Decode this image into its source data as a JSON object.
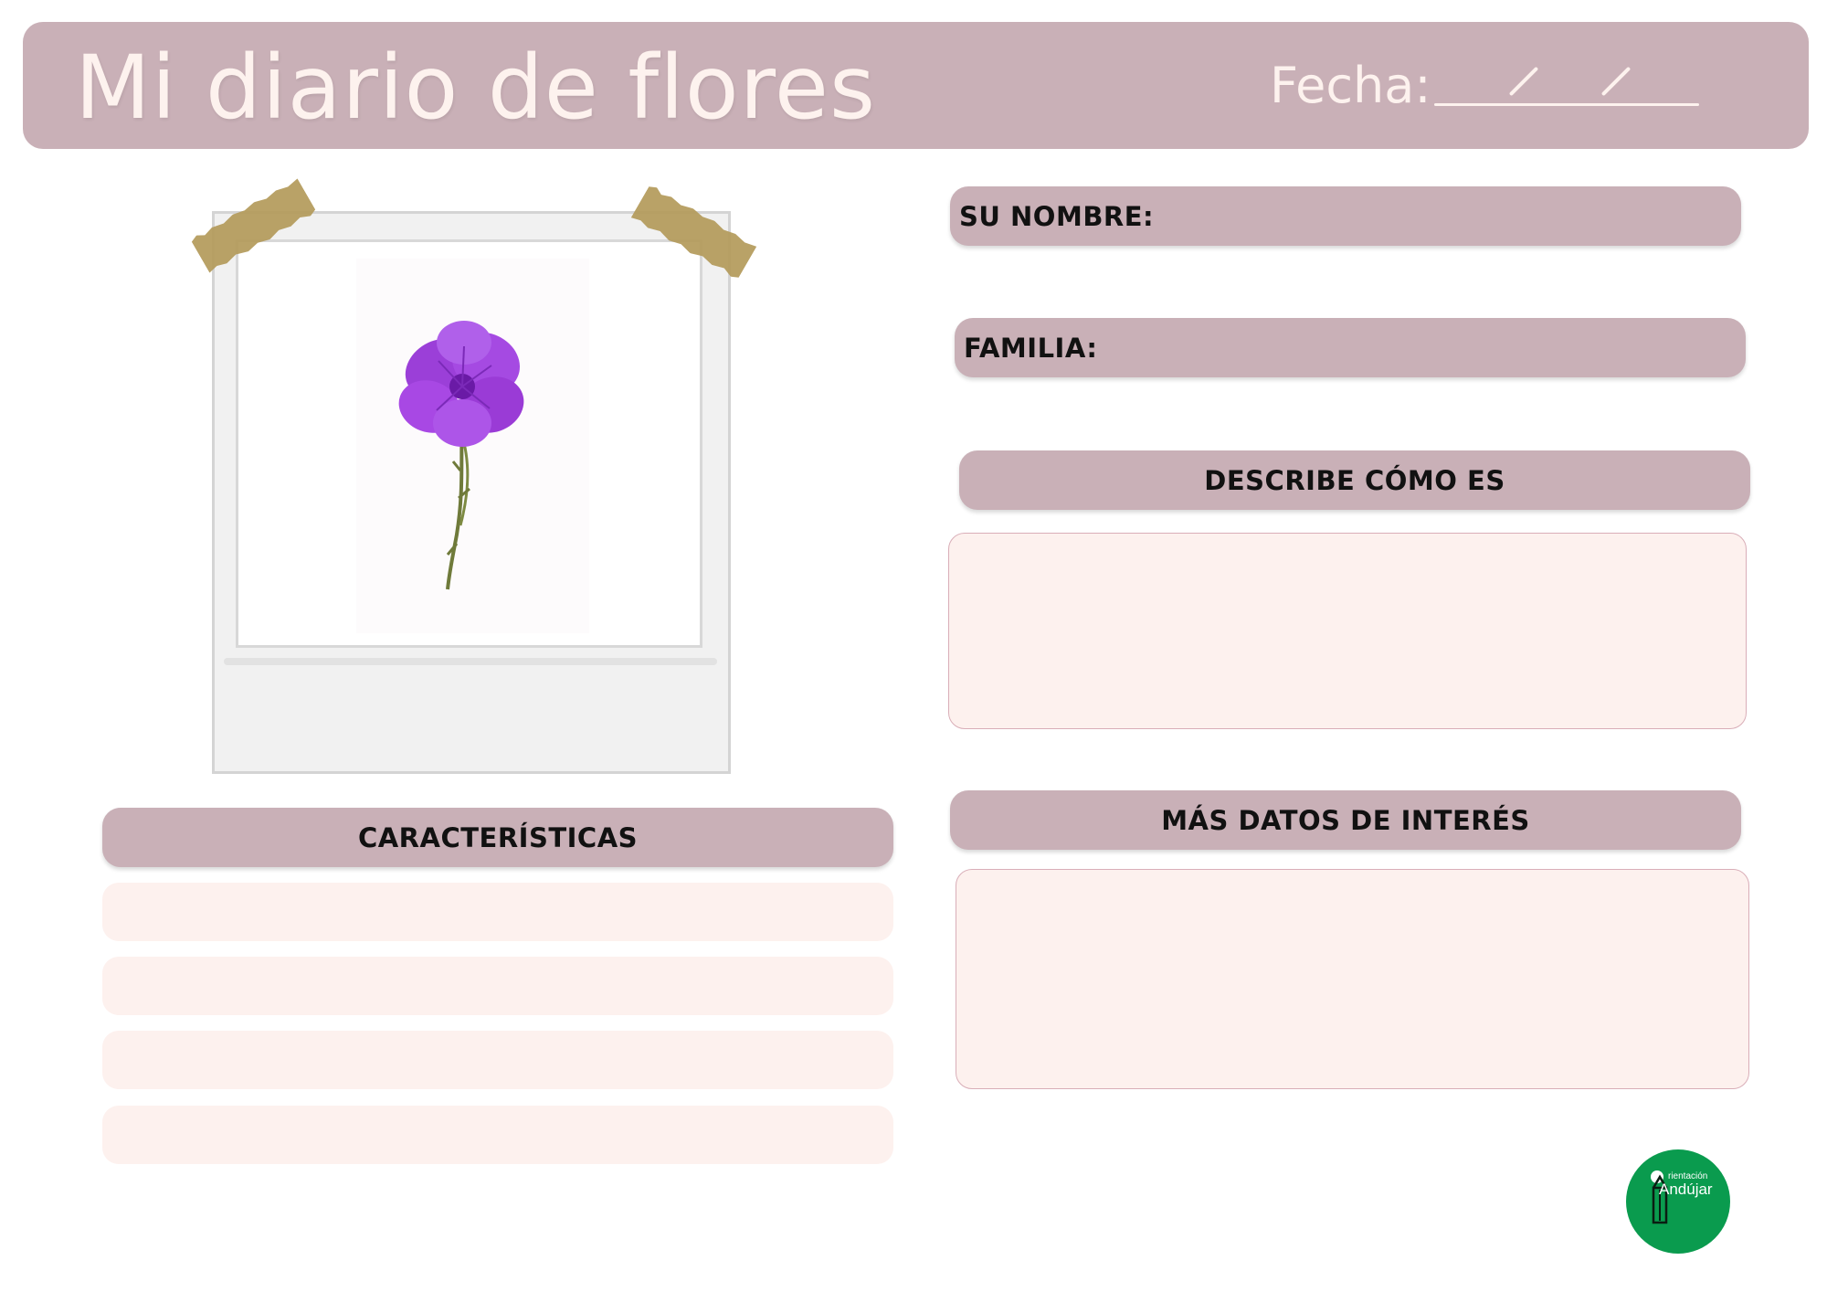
{
  "header": {
    "title": "Mi diario de flores",
    "date_label": "Fecha:"
  },
  "fields": {
    "name_label": "SU NOMBRE:",
    "family_label": "FAMILIA:",
    "describe_label": "DESCRIBE CÓMO ES",
    "characteristics_label": "CARACTERÍSTICAS",
    "more_data_label": "MÁS DATOS DE INTERÉS"
  },
  "logo": {
    "line1": "rientación",
    "line2": "Andújar"
  },
  "colors": {
    "accent": "#c9b0b7",
    "box_fill": "#fdf1ee",
    "logo_green": "#0a9b4e",
    "flower": "#a047e0"
  },
  "icons": [
    "photo-frame-icon",
    "tape-icon",
    "flower-icon",
    "pencil-icon"
  ]
}
